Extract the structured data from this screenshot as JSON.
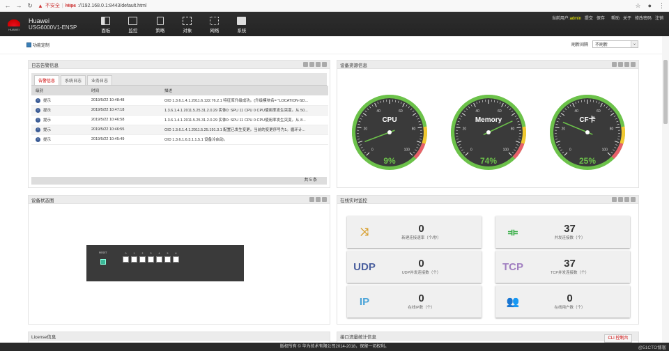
{
  "browser": {
    "warning_label": "不安全",
    "protocol": "https",
    "url": "://192.168.0.1:8443/default.html"
  },
  "header": {
    "brand": "HUAWEI",
    "product_line1": "Huawei",
    "product_line2": "USG6000V1-ENSP",
    "nav": [
      {
        "label": "面板",
        "icon": "dashboard-icon"
      },
      {
        "label": "监控",
        "icon": "monitor-icon"
      },
      {
        "label": "策略",
        "icon": "policy-icon"
      },
      {
        "label": "对象",
        "icon": "object-icon"
      },
      {
        "label": "网络",
        "icon": "network-icon"
      },
      {
        "label": "系统",
        "icon": "system-icon"
      }
    ],
    "current_user_label": "当前用户:",
    "current_user": "admin",
    "links": [
      "提交",
      "保存",
      "帮助",
      "关于",
      "修改密码",
      "注销"
    ]
  },
  "toolbar": {
    "func_custom": "功能定制",
    "refresh_label": "刷新间隔",
    "refresh_value": "不刷新"
  },
  "log_panel": {
    "title": "日志告警信息",
    "tabs": [
      "告警信息",
      "系统日志",
      "业务日志"
    ],
    "columns": [
      "级别",
      "时间",
      "描述"
    ],
    "rows": [
      {
        "level": "提示",
        "time": "2019/5/22 10:48:48",
        "desc": "OID 1.3.6.1.4.1.2011.6.122.76.2.1 特征库升级成功。(升级模块名= \"LOCATION-SD..."
      },
      {
        "level": "提示",
        "time": "2019/5/22 10:47:18",
        "desc": "1.3.6.1.4.1.2011.5.25.31.2.0.29 实体0: SPU 11 CPU 0 CPU使用率发生突变。从 50..."
      },
      {
        "level": "提示",
        "time": "2019/5/22 10:46:58",
        "desc": "1.3.6.1.4.1.2011.5.25.31.2.0.29 实体0: SPU 11 CPU 0 CPU使用率发生突变。从 8..."
      },
      {
        "level": "提示",
        "time": "2019/5/22 10:46:55",
        "desc": "OID 1.3.6.1.4.1.2011.5.25.191.3.1 配置已发生变更。当前的变更序号为1。循环计..."
      },
      {
        "level": "提示",
        "time": "2019/5/22 10:45:49",
        "desc": "OID 1.3.6.1.6.3.1.1.5.1 设备冷启动。"
      }
    ],
    "total": "共 5 条"
  },
  "resource_panel": {
    "title": "设备资源信息",
    "gauges": [
      {
        "label": "CPU",
        "value": 9,
        "text": "9%"
      },
      {
        "label": "Memory",
        "value": 74,
        "text": "74%"
      },
      {
        "label": "CF卡",
        "value": 25,
        "text": "25%"
      }
    ],
    "ticks": [
      "0",
      "20",
      "40",
      "60",
      "80",
      "100"
    ]
  },
  "device_panel": {
    "title": "设备状态图",
    "reset_label": "RESET",
    "ports": [
      "0",
      "1",
      "2",
      "3",
      "4",
      "5",
      "6"
    ]
  },
  "monitor_panel": {
    "title": "在线实时监控",
    "cards": [
      {
        "icon": "new-connection-icon",
        "icon_text": "",
        "value": "0",
        "label": "新建连接速率（个/秒）"
      },
      {
        "icon": "concurrent-connection-icon",
        "icon_text": "",
        "value": "37",
        "label": "并发连接数（个）"
      },
      {
        "icon": "udp-icon",
        "icon_text": "UDP",
        "value": "0",
        "label": "UDP并发连接数（个）"
      },
      {
        "icon": "tcp-icon",
        "icon_text": "TCP",
        "value": "37",
        "label": "TCP并发连接数（个）"
      },
      {
        "icon": "ip-icon",
        "icon_text": "IP",
        "value": "0",
        "label": "在线IP数（个）"
      },
      {
        "icon": "users-icon",
        "icon_text": "",
        "value": "0",
        "label": "在线用户数（个）"
      }
    ]
  },
  "bottom_panels": {
    "left_title": "License信息",
    "right_title": "接口流量统计信息"
  },
  "footer": {
    "copyright": "版权所有 © 华为技术有限公司2014-2018，保留一切权利。",
    "cli": "CLI 控制台",
    "watermark": "@51CTO博客"
  },
  "colors": {
    "gauge_green": "#6cc24a",
    "gauge_yellow": "#f2c830",
    "gauge_red": "#e8606a",
    "udp": "#4a5f9e",
    "tcp": "#a07ec0",
    "ip": "#4aa3d8",
    "users": "#c0393b",
    "share": "#d8a030",
    "concurrent": "#3bb04a"
  }
}
